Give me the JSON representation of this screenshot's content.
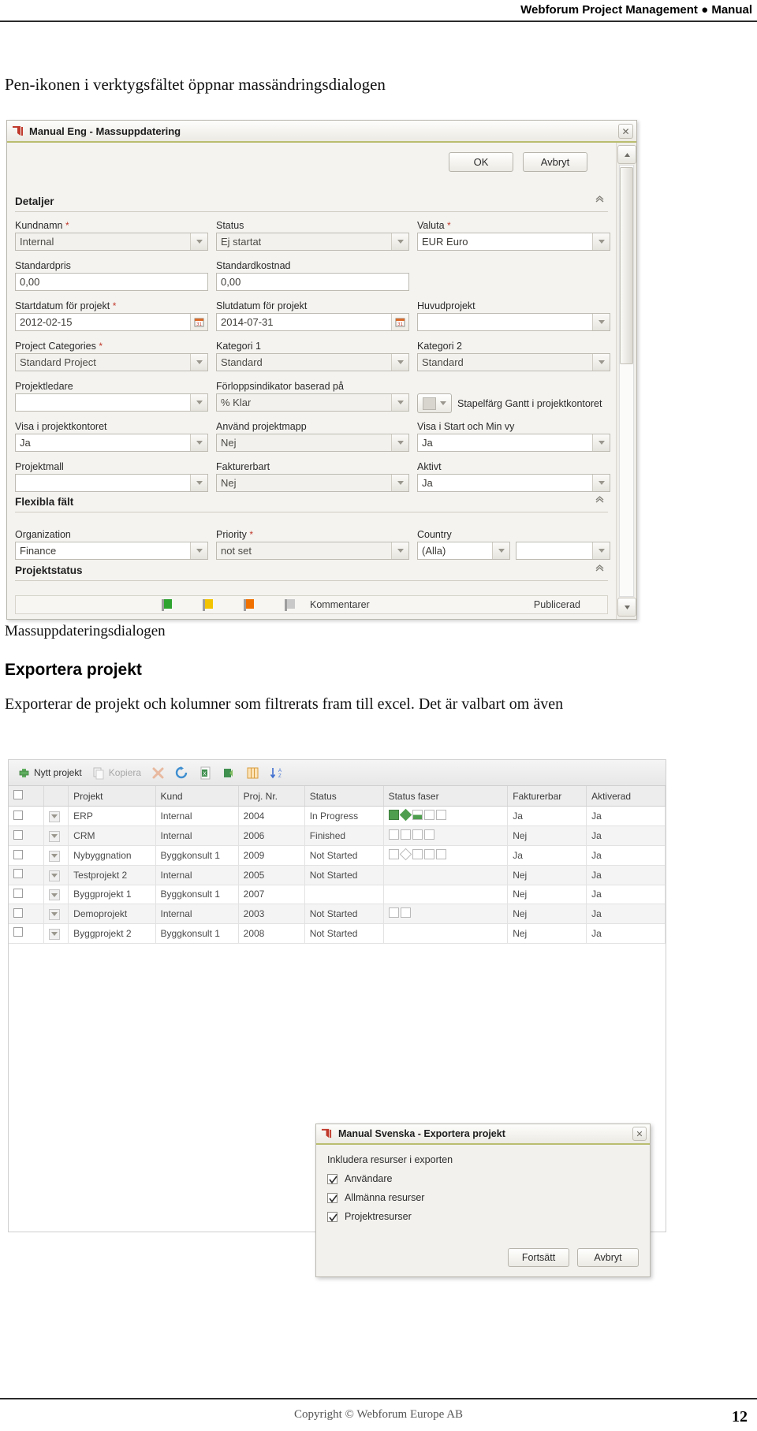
{
  "page": {
    "header": "Webforum Project Management ● Manual",
    "footer_copyright": "Copyright © Webforum Europe AB",
    "page_number": "12"
  },
  "doc": {
    "heading_top": "Pen-ikonen i verktygsfältet öppnar massändringsdialogen",
    "caption_mass": "Massuppdateringsdialogen",
    "heading_export": "Exportera projekt",
    "paragraph_export": "Exporterar de projekt och kolumner som filtrerats fram till excel. Det är valbart om även"
  },
  "mass_dialog": {
    "title": "Manual Eng - Massuppdatering",
    "logo_icon": "webforum-logo-icon",
    "close_icon": "close-icon",
    "buttons": {
      "ok": "OK",
      "cancel": "Avbryt"
    },
    "sections": {
      "details": "Detaljer",
      "flexible": "Flexibla fält",
      "project_status": "Projektstatus"
    },
    "fields": [
      {
        "label": "Kundnamn",
        "required": true,
        "value": "Internal",
        "control": "dropdown"
      },
      {
        "label": "Status",
        "required": false,
        "value": "Ej startat",
        "control": "dropdown"
      },
      {
        "label": "Valuta",
        "required": true,
        "value": "EUR Euro",
        "control": "dropdown"
      },
      {
        "label": "Standardpris",
        "required": false,
        "value": "0,00",
        "control": "text"
      },
      {
        "label": "Standardkostnad",
        "required": false,
        "value": "0,00",
        "control": "text"
      },
      {
        "label": "Startdatum för projekt",
        "required": true,
        "value": "2012-02-15",
        "control": "date"
      },
      {
        "label": "Slutdatum för projekt",
        "required": false,
        "value": "2014-07-31",
        "control": "date"
      },
      {
        "label": "Huvudprojekt",
        "required": false,
        "value": "",
        "control": "dropdown"
      },
      {
        "label": "Project Categories",
        "required": true,
        "value": "Standard Project",
        "control": "dropdown"
      },
      {
        "label": "Kategori 1",
        "required": false,
        "value": "Standard",
        "control": "dropdown"
      },
      {
        "label": "Kategori 2",
        "required": false,
        "value": "Standard",
        "control": "dropdown"
      },
      {
        "label": "Projektledare",
        "required": false,
        "value": "",
        "control": "dropdown"
      },
      {
        "label": "Förloppsindikator baserad på",
        "required": false,
        "value": "% Klar",
        "control": "dropdown"
      },
      {
        "label": "Visa i projektkontoret",
        "required": false,
        "value": "Ja",
        "control": "dropdown"
      },
      {
        "label": "Använd projektmapp",
        "required": false,
        "value": "Nej",
        "control": "dropdown"
      },
      {
        "label": "Visa i Start och Min vy",
        "required": false,
        "value": "Ja",
        "control": "dropdown"
      },
      {
        "label": "Projektmall",
        "required": false,
        "value": "",
        "control": "dropdown"
      },
      {
        "label": "Fakturerbart",
        "required": false,
        "value": "Nej",
        "control": "dropdown"
      },
      {
        "label": "Aktivt",
        "required": false,
        "value": "Ja",
        "control": "dropdown"
      },
      {
        "label": "Organization",
        "required": false,
        "value": "Finance",
        "control": "dropdown"
      },
      {
        "label": "Priority",
        "required": true,
        "value": "not set",
        "control": "dropdown"
      },
      {
        "label": "Country",
        "required": false,
        "value": "(Alla)",
        "control": "dropdown"
      }
    ],
    "gantt_color": {
      "label": "Stapelfärg Gantt i projektkontoret",
      "swatch": "#d7d5cd"
    },
    "status_row": {
      "comments_label": "Kommentarer",
      "published_label": "Publicerad",
      "flags": [
        "#2fa32f",
        "#f2c300",
        "#f07000",
        "#b9b9b9"
      ]
    }
  },
  "project_grid": {
    "toolbar": [
      {
        "label": "Nytt projekt",
        "icon": "add-icon",
        "disabled": false
      },
      {
        "label": "Kopiera",
        "icon": "copy-icon",
        "disabled": true
      },
      {
        "label": "",
        "icon": "delete-icon",
        "disabled": true
      },
      {
        "label": "",
        "icon": "refresh-icon",
        "disabled": false
      },
      {
        "label": "",
        "icon": "excel-icon",
        "disabled": false
      },
      {
        "label": "",
        "icon": "import-icon",
        "disabled": false
      },
      {
        "label": "",
        "icon": "columns-icon",
        "disabled": false
      },
      {
        "label": "",
        "icon": "sort-icon",
        "disabled": false
      }
    ],
    "columns": [
      "",
      "",
      "Projekt",
      "Kund",
      "Proj. Nr.",
      "Status",
      "Status faser",
      "Fakturerbar",
      "Aktiverad"
    ],
    "rows": [
      {
        "projekt": "ERP",
        "kund": "Internal",
        "nr": "2004",
        "status": "In Progress",
        "phases": [
          "green",
          "diamond",
          "half",
          "empty",
          "empty"
        ],
        "fakturerbar": "Ja",
        "aktiverad": "Ja"
      },
      {
        "projekt": "CRM",
        "kund": "Internal",
        "nr": "2006",
        "status": "Finished",
        "phases": [
          "empty",
          "empty",
          "empty",
          "empty"
        ],
        "fakturerbar": "Nej",
        "aktiverad": "Ja"
      },
      {
        "projekt": "Nybyggnation",
        "kund": "Byggkonsult 1",
        "nr": "2009",
        "status": "Not Started",
        "phases": [
          "empty",
          "diamond-hollow",
          "empty",
          "empty",
          "empty"
        ],
        "fakturerbar": "Ja",
        "aktiverad": "Ja"
      },
      {
        "projekt": "Testprojekt 2",
        "kund": "Internal",
        "nr": "2005",
        "status": "Not Started",
        "phases": [],
        "fakturerbar": "Nej",
        "aktiverad": "Ja"
      },
      {
        "projekt": "Byggprojekt 1",
        "kund": "Byggkonsult 1",
        "nr": "2007",
        "status": "",
        "phases": [],
        "fakturerbar": "Nej",
        "aktiverad": "Ja"
      },
      {
        "projekt": "Demoprojekt",
        "kund": "Internal",
        "nr": "2003",
        "status": "Not Started",
        "phases": [
          "empty",
          "empty"
        ],
        "fakturerbar": "Nej",
        "aktiverad": "Ja"
      },
      {
        "projekt": "Byggprojekt 2",
        "kund": "Byggkonsult 1",
        "nr": "2008",
        "status": "Not Started",
        "phases": [],
        "fakturerbar": "Nej",
        "aktiverad": "Ja"
      }
    ]
  },
  "export_dialog": {
    "title": "Manual Svenska - Exportera projekt",
    "logo_icon": "webforum-logo-icon",
    "close_icon": "close-icon",
    "intro": "Inkludera resurser i exporten",
    "options": [
      {
        "label": "Användare",
        "checked": true
      },
      {
        "label": "Allmänna resurser",
        "checked": true
      },
      {
        "label": "Projektresurser",
        "checked": true
      }
    ],
    "buttons": {
      "continue": "Fortsätt",
      "cancel": "Avbryt"
    }
  }
}
